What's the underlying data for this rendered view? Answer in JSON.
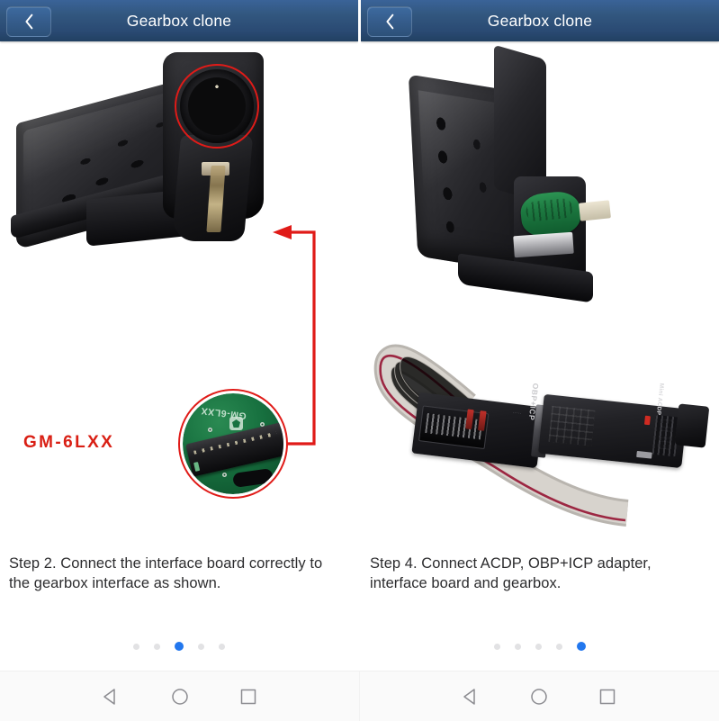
{
  "app": {
    "panels": [
      {
        "id": "left",
        "header": {
          "title": "Gearbox clone",
          "back_icon": "chevron-left-icon"
        },
        "figure": {
          "label": "GM-6LXX",
          "label_color": "#d91f14",
          "highlight_color": "#e01b18",
          "callout_silkscreen": "GM-6LXX",
          "subject": "gearbox TCM module with round multi-pin connector highlighted in red, red arrow pointing from circular close-up of the GM-6LXX interface board"
        },
        "caption": "Step 2. Connect the interface board correctly to the gearbox interface as shown.",
        "pagination": {
          "count": 5,
          "active_index": 2,
          "active_color": "#2277ee",
          "inactive_color": "#e2e2e4"
        }
      },
      {
        "id": "right",
        "header": {
          "title": "Gearbox clone",
          "back_icon": "chevron-left-icon"
        },
        "figure": {
          "obp_label": "OBP+ICP",
          "acdp_label": "Mini ACDP",
          "subject": "gearbox TCM module with interface board installed, grey ribbon cable running to the OBP+ICP adapter which plugs into the Mini ACDP programmer"
        },
        "caption": "Step 4. Connect ACDP, OBP+ICP adapter, interface board and gearbox.",
        "pagination": {
          "count": 5,
          "active_index": 4,
          "active_color": "#2277ee",
          "inactive_color": "#e2e2e4"
        }
      }
    ],
    "navbar": {
      "buttons": [
        {
          "name": "back-button",
          "icon": "triangle-left-icon"
        },
        {
          "name": "home-button",
          "icon": "circle-icon"
        },
        {
          "name": "recents-button",
          "icon": "square-icon"
        }
      ]
    },
    "theme": {
      "header_bg": "#2a4a73",
      "header_text": "#ffffff",
      "caption_text": "#2c2c2e",
      "page_bg": "#ffffff",
      "navbar_bg": "#fafafa",
      "navbar_icon": "#8b8b90"
    }
  }
}
